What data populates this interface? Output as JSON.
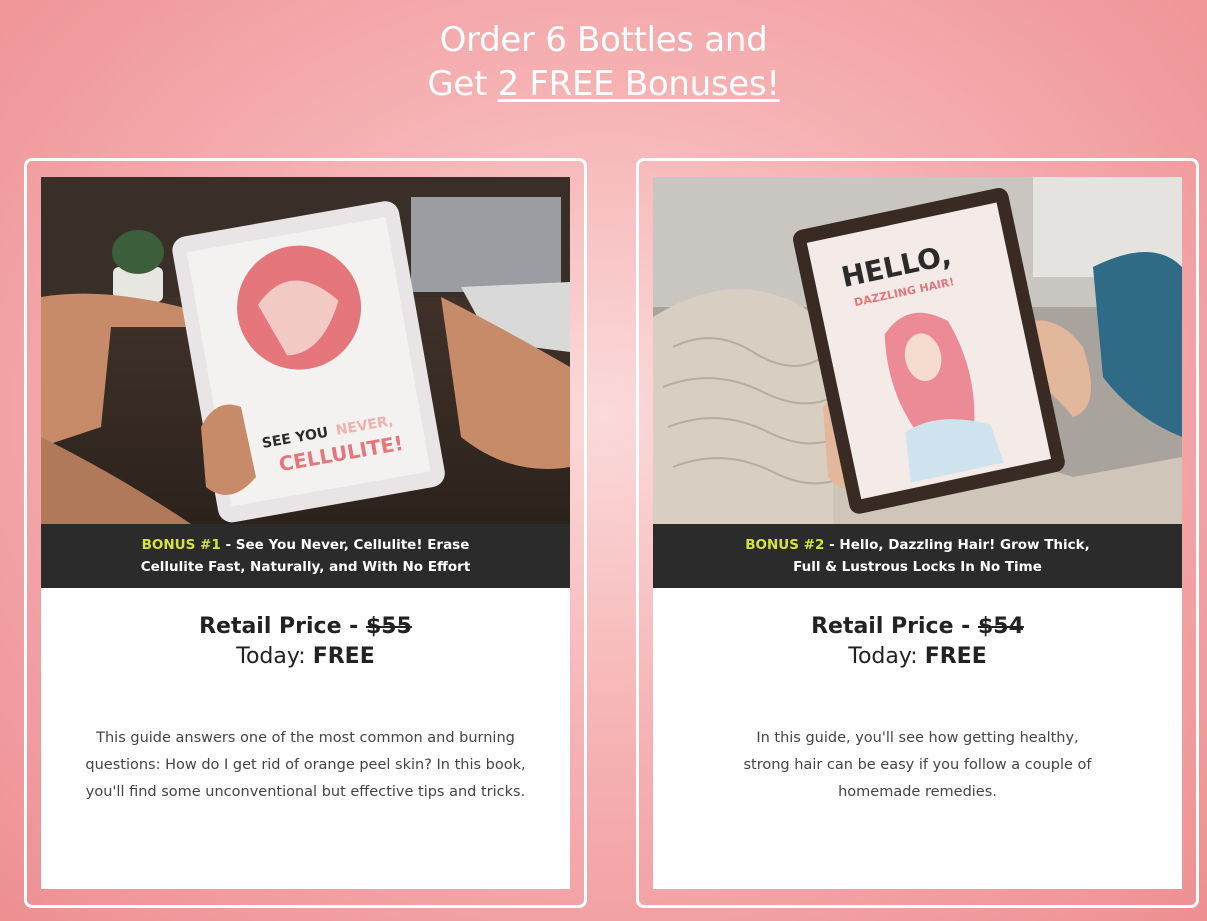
{
  "header": {
    "line1": "Order 6 Bottles and",
    "line2_prefix": "Get ",
    "line2_emphasis": "2 FREE Bonuses!"
  },
  "bonuses": [
    {
      "tag": "BONUS #1",
      "caption_line1": " - See You Never, Cellulite! Erase",
      "caption_line2": "Cellulite Fast, Naturally, and With No Effort",
      "price_label": "Retail Price - ",
      "retail_price": "$55",
      "today_label": "Today: ",
      "today_value": "FREE",
      "description": "This guide answers one of the most common and burning questions: How do I get rid of orange peel skin? In this book, you'll find some unconventional but effective tips and tricks.",
      "cover_text_a": "SEE YOU",
      "cover_text_b": "NEVER,",
      "cover_text_c": "CELLULITE!"
    },
    {
      "tag": "BONUS #2",
      "caption_line1": " - Hello, Dazzling Hair! Grow Thick,",
      "caption_line2": "Full & Lustrous Locks In No Time",
      "price_label": "Retail Price - ",
      "retail_price": "$54",
      "today_label": "Today: ",
      "today_value": "FREE",
      "description": "In this guide, you'll see how getting healthy, strong hair can be easy if you follow a couple of homemade remedies.",
      "cover_text_a": "HELLO,",
      "cover_text_b": "DAZZLING HAIR!"
    }
  ],
  "colors": {
    "background": "#f6b2b4",
    "caption_bar": "#2b2b2b",
    "bonus_tag": "#d6e43a",
    "accent_pink": "#e4767c"
  }
}
